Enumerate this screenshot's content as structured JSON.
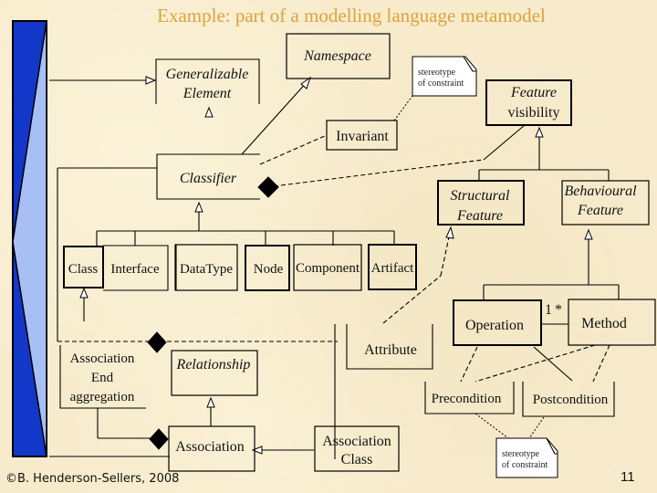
{
  "slide": {
    "title": "Example: part of a modelling language metamodel",
    "footer_copyright": "©B. Henderson-Sellers, 2008",
    "page_number": "11"
  },
  "colors": {
    "title": "#dba33c",
    "background": "#f7ebcc",
    "accent_dark_blue": "#1237c9",
    "accent_light_blue": "#a8bff5"
  },
  "diagram": {
    "classes": {
      "generalizable_element": [
        "Generalizable",
        "Element"
      ],
      "namespace": "Namespace",
      "invariant": "Invariant",
      "feature_visibility": [
        "Feature",
        "visibility"
      ],
      "classifier": "Classifier",
      "structural_feature": [
        "Structural",
        "Feature"
      ],
      "behavioural_feature": [
        "Behavioural",
        "Feature"
      ],
      "class": "Class",
      "interface": "Interface",
      "datatype": "DataType",
      "node": "Node",
      "component": "Component",
      "artifact": "Artifact",
      "operation": "Operation",
      "method": "Method",
      "attribute": "Attribute",
      "association_end": [
        "Association",
        "End",
        "aggregation"
      ],
      "relationship": "Relationship",
      "association": "Association",
      "association_class": [
        "Association",
        "Class"
      ],
      "precondition": "Precondition",
      "postcondition": "Postcondition"
    },
    "notes": {
      "top": [
        "stereotype",
        "of constraint"
      ],
      "bottom": [
        "stereotype",
        "of constraint"
      ]
    },
    "multiplicity": {
      "operation_end": "1",
      "method_end": "*"
    }
  }
}
